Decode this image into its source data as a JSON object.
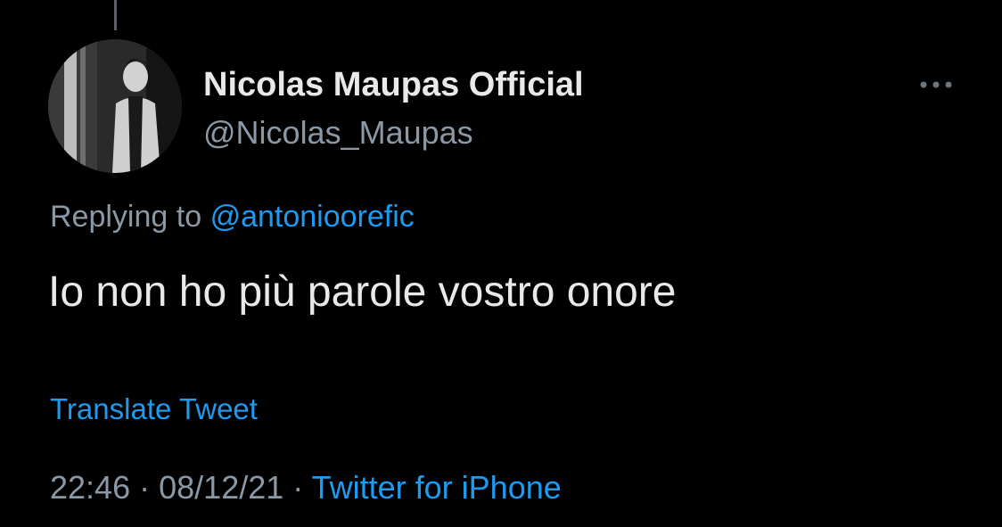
{
  "tweet": {
    "display_name": "Nicolas Maupas Official",
    "handle": "@Nicolas_Maupas",
    "replying_prefix": "Replying to",
    "replying_to": "@antonioorefic",
    "text": "Io non ho più parole vostro onore",
    "translate_label": "Translate Tweet",
    "time": "22:46",
    "separator": "·",
    "date": "08/12/21",
    "source": "Twitter for iPhone"
  },
  "icons": {
    "more": "more-horizontal-icon",
    "avatar": "profile-photo"
  },
  "colors": {
    "background": "#000000",
    "primary_text": "#e7e9ea",
    "secondary_text": "#8b98a5",
    "accent": "#1d9bf0"
  }
}
